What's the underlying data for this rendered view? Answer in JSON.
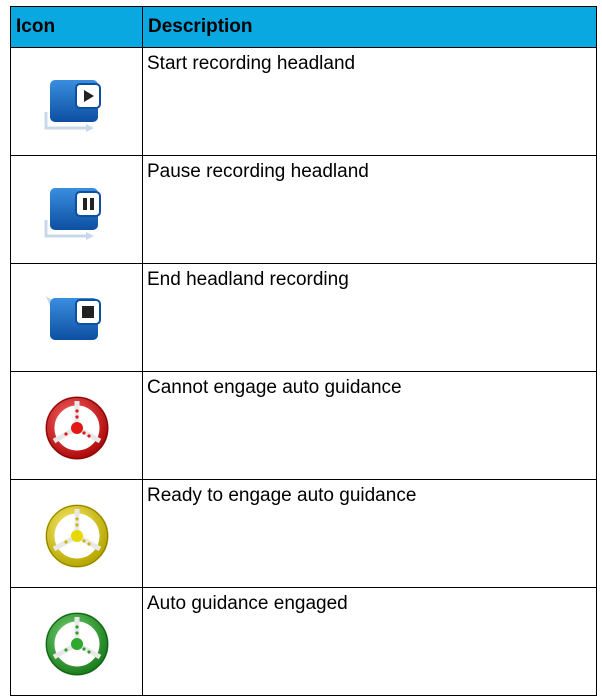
{
  "table": {
    "headers": {
      "icon": "Icon",
      "description": "Description"
    },
    "rows": [
      {
        "icon": "start-recording-headland-icon",
        "description": "Start recording headland"
      },
      {
        "icon": "pause-recording-headland-icon",
        "description": "Pause recording headland"
      },
      {
        "icon": "end-headland-recording-icon",
        "description": "End headland recording"
      },
      {
        "icon": "steering-wheel-red-icon",
        "description": "Cannot engage auto guidance"
      },
      {
        "icon": "steering-wheel-yellow-icon",
        "description": "Ready to engage auto guidance"
      },
      {
        "icon": "steering-wheel-green-icon",
        "description": "Auto guidance engaged"
      }
    ]
  },
  "colors": {
    "header_background": "#0aa8e0",
    "recording_blue": "#1565c0",
    "wheel_red": "#d01818",
    "wheel_yellow": "#d8c800",
    "wheel_green": "#2e9e2e"
  }
}
